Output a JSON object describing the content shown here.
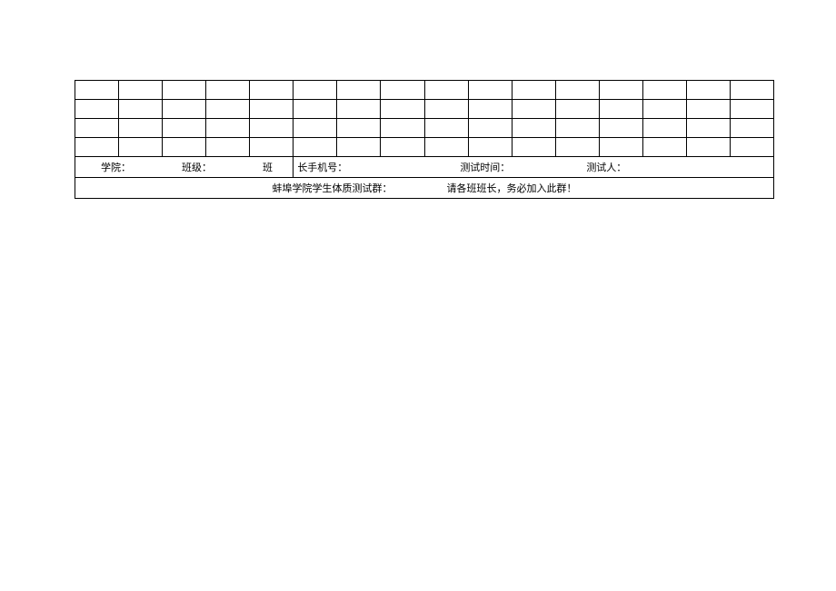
{
  "grid": {
    "cols": 16,
    "emptyRows": 4
  },
  "info": {
    "college_label": "学院：",
    "class_label": "班级：",
    "ban_suffix": "班",
    "phone_label": "长手机号：",
    "test_time_label": "测试时间：",
    "tester_label": "测试人："
  },
  "footer": {
    "group_label": "蚌埠学院学生体质测试群：",
    "notice": "请各班班长，务必加入此群！"
  }
}
